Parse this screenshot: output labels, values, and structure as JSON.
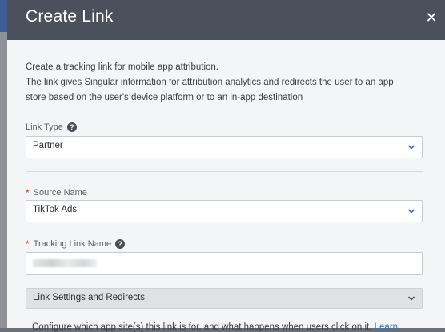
{
  "dialog": {
    "title": "Create Link",
    "close_symbol": "✕"
  },
  "description": {
    "line1": "Create a tracking link for mobile app attribution.",
    "line2": "The link gives Singular information for attribution analytics and redirects the user to an app",
    "line3": "store based on the user's device platform or to an in-app destination"
  },
  "link_type": {
    "label": "Link Type",
    "value": "Partner",
    "help_icon": "question-circle-icon"
  },
  "source_name": {
    "label": "Source Name",
    "required_mark": "*",
    "value": "TikTok Ads"
  },
  "tracking_link_name": {
    "label": "Tracking Link Name",
    "required_mark": "*",
    "help_icon": "question-circle-icon",
    "value_redacted": true
  },
  "link_settings": {
    "title": "Link Settings and Redirects"
  },
  "footer_text": {
    "text": "Configure which app site(s) this link is for, and what happens when users click on it.",
    "link": "Learn"
  },
  "colors": {
    "header_bg": "#4a515c",
    "body_bg": "#f4f5f6",
    "required": "#d8322a",
    "accent_chevron": "#2f74c0",
    "link": "#2f74c0"
  }
}
